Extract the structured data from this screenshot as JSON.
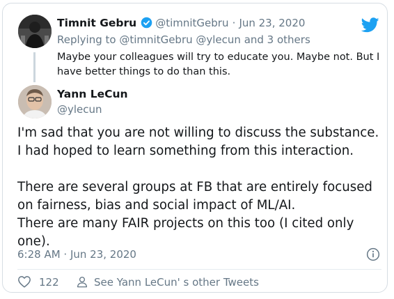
{
  "reply_tweet": {
    "author_name": "Timnit Gebru",
    "handle": "@timnitGebru",
    "separator": "·",
    "date": "Jun 23, 2020",
    "replying_to_prefix": "Replying to",
    "replying_to": "@timnitGebru @ylecun and 3 others",
    "text_line1": "Maybe your colleagues will try to educate you. Maybe not. But I",
    "text_line2": "have better things to do than this."
  },
  "main_tweet": {
    "author_name": "Yann LeCun",
    "handle": "@ylecun",
    "lines": [
      "I'm sad that you are not willing to discuss the substance.",
      "I had hoped to learn something from this interaction.",
      "There are several groups at FB that are entirely focused",
      "on fairness, bias and social impact of ML/AI.",
      "There are many FAIR projects on this too (I cited only",
      "one)."
    ],
    "timestamp": "6:28 AM · Jun 23, 2020",
    "like_count": "122",
    "see_more": "See Yann LeCun' s other Tweets"
  },
  "icons": {
    "logo": "twitter-bird-icon",
    "verified": "verified-badge-icon",
    "info": "info-icon",
    "like": "heart-icon",
    "profile": "person-icon"
  },
  "colors": {
    "twitter_blue": "#1da1f2",
    "muted": "#657786",
    "text": "#14171a"
  }
}
